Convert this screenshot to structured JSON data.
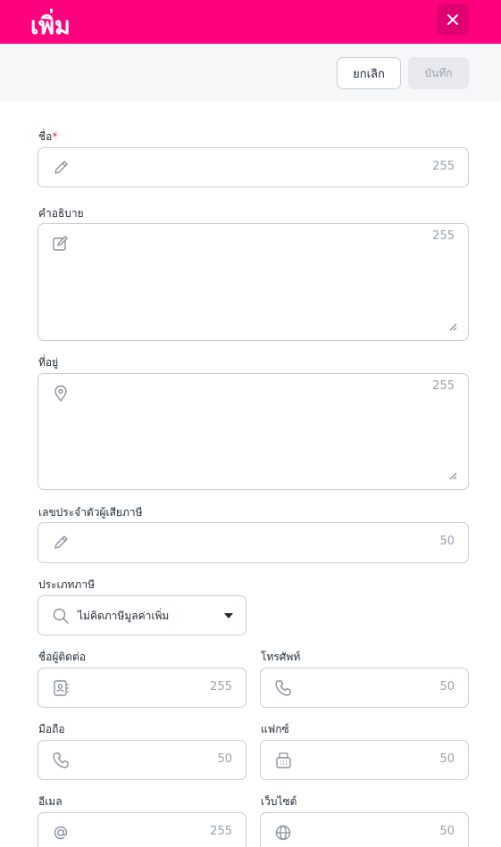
{
  "header": {
    "title": "เพิ่ม"
  },
  "toolbar": {
    "cancel_label": "ยกเลิก",
    "save_label": "บันทึก"
  },
  "form": {
    "name": {
      "label": "ชื่อ",
      "required_mark": "*",
      "max_length": "255"
    },
    "description": {
      "label": "คำอธิบาย",
      "max_length": "255"
    },
    "address": {
      "label": "ที่อยู่",
      "max_length": "255"
    },
    "tax_id": {
      "label": "เลขประจำตัวผู้เสียภาษี",
      "max_length": "50"
    },
    "tax_type": {
      "label": "ประเภทภาษี",
      "selected": "ไม่คิดภาษีมูลค่าเพิ่ม"
    },
    "contact_name": {
      "label": "ชื่อผู้ติดต่อ",
      "max_length": "255"
    },
    "phone": {
      "label": "โทรศัพท์",
      "max_length": "50"
    },
    "mobile": {
      "label": "มือถือ",
      "max_length": "50"
    },
    "fax": {
      "label": "แฟกซ์",
      "max_length": "50"
    },
    "email": {
      "label": "อีเมล",
      "max_length": "255"
    },
    "website": {
      "label": "เว็บไซต์",
      "max_length": "50"
    }
  },
  "colors": {
    "accent": "#ff007f",
    "border": "#c9ccd3",
    "muted": "#9aa1ad"
  }
}
